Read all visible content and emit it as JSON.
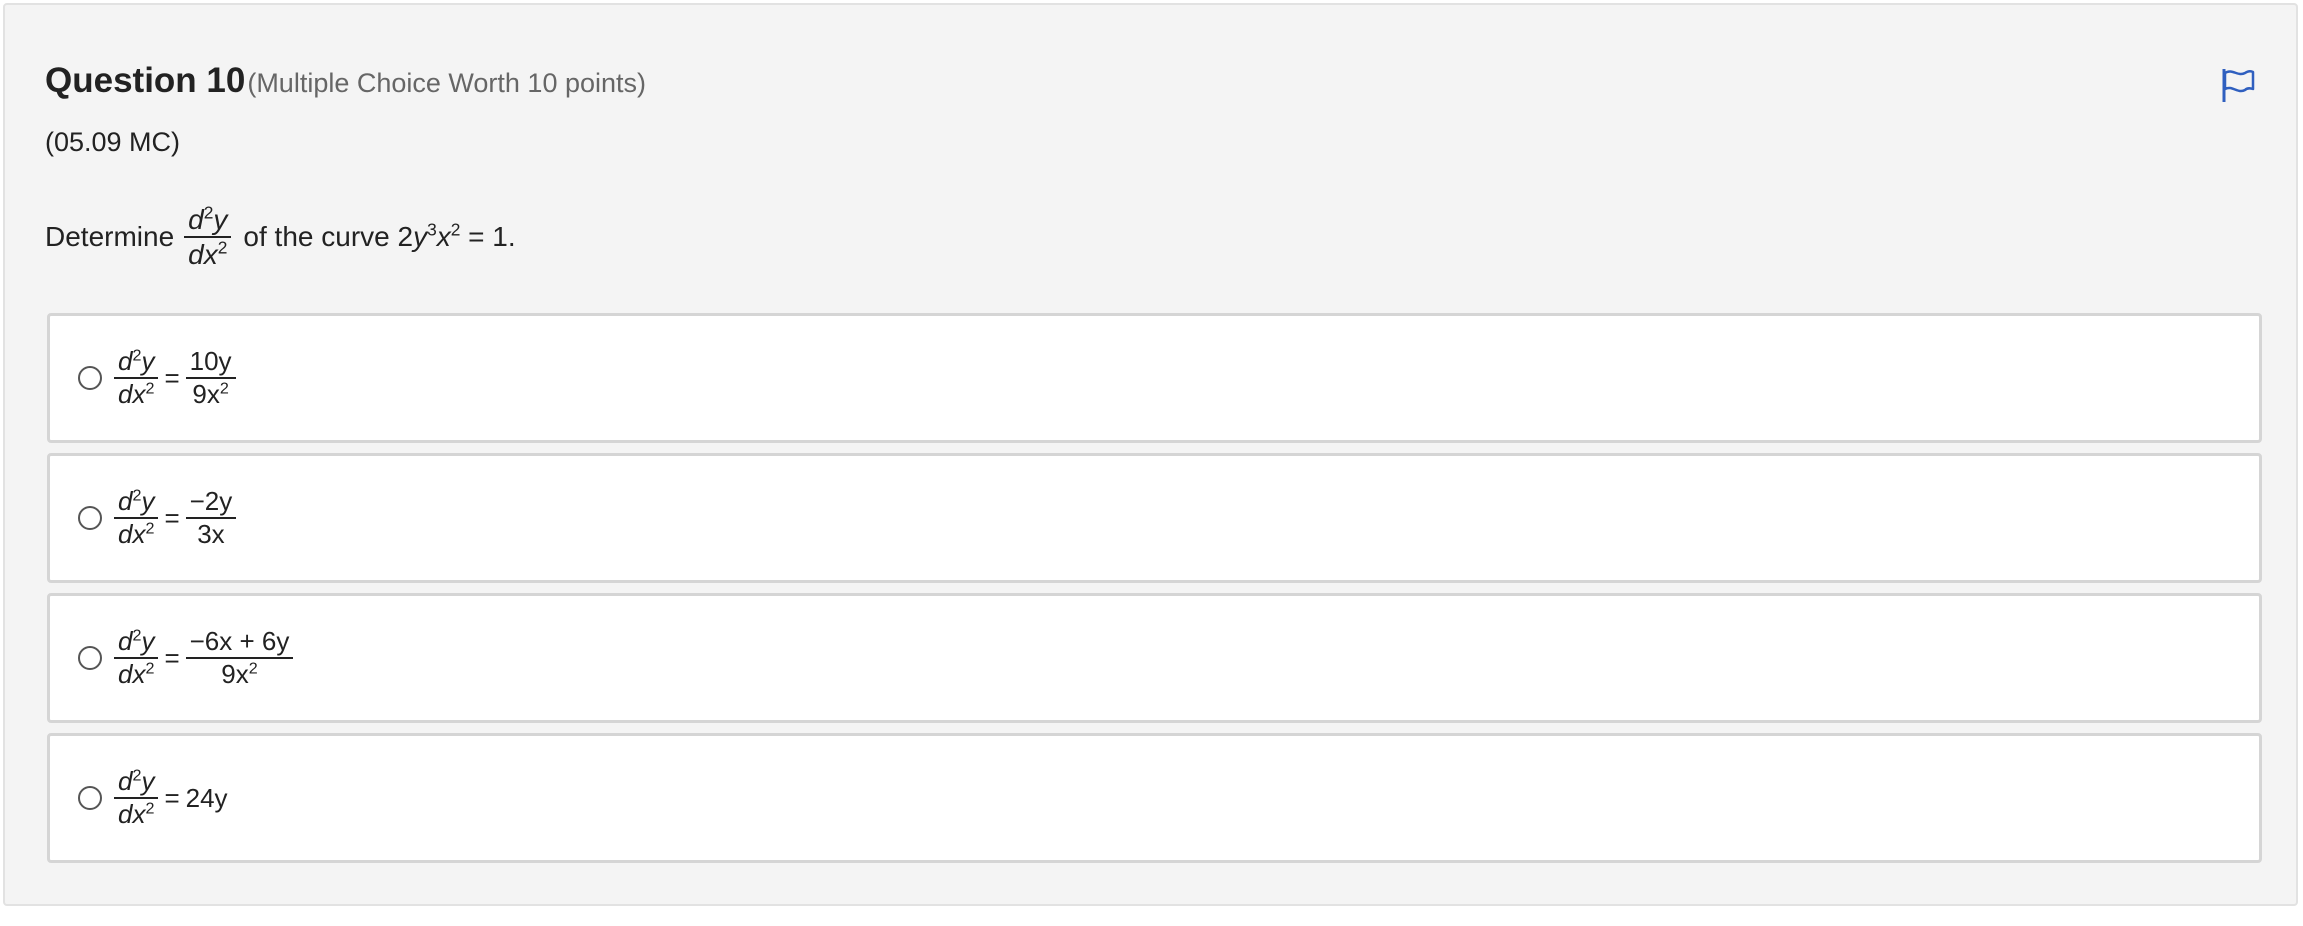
{
  "question": {
    "title": "Question 10",
    "worth": "(Multiple Choice Worth 10 points)",
    "code": "(05.09 MC)",
    "flag_icon": "flag-icon"
  },
  "prompt": {
    "lead": "Determine",
    "derivative_num": "d",
    "derivative_sup": "2",
    "derivative_var": "y",
    "derivative_den": "dx",
    "derivative_den_sup": "2",
    "tail_pre": "of the curve 2",
    "tail_y": "y",
    "tail_sup3": "3",
    "tail_x": "x",
    "tail_sup2": "2",
    "tail_post": " = 1."
  },
  "options": [
    {
      "lhs_num": "d",
      "lhs_sup": "2",
      "lhs_var": "y",
      "lhs_den": "dx",
      "lhs_den_sup": "2",
      "equals": "=",
      "rhs_num": "10y",
      "rhs_den": "9x",
      "rhs_den_sup": "2"
    },
    {
      "lhs_num": "d",
      "lhs_sup": "2",
      "lhs_var": "y",
      "lhs_den": "dx",
      "lhs_den_sup": "2",
      "equals": "=",
      "rhs_num": "−2y",
      "rhs_den": "3x",
      "rhs_den_sup": ""
    },
    {
      "lhs_num": "d",
      "lhs_sup": "2",
      "lhs_var": "y",
      "lhs_den": "dx",
      "lhs_den_sup": "2",
      "equals": "=",
      "rhs_num": "−6x + 6y",
      "rhs_den": "9x",
      "rhs_den_sup": "2"
    },
    {
      "lhs_num": "d",
      "lhs_sup": "2",
      "lhs_var": "y",
      "lhs_den": "dx",
      "lhs_den_sup": "2",
      "equals": "=",
      "rhs_inline": "24y"
    }
  ]
}
